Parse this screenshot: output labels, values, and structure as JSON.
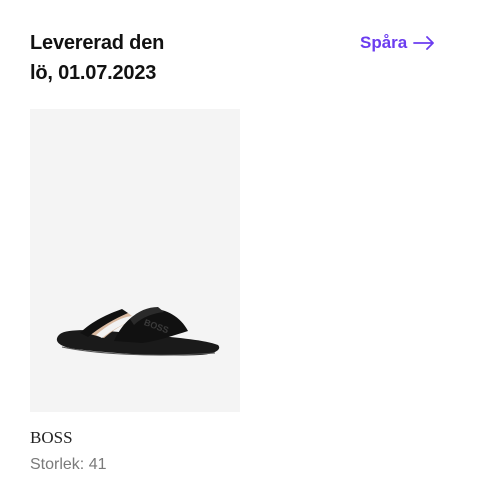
{
  "delivery": {
    "status_line1": "Levererad den",
    "status_line2": "lö, 01.07.2023"
  },
  "track": {
    "label": "Spåra",
    "icon": "arrow-right-icon",
    "color": "#6b3cf0"
  },
  "product": {
    "brand": "BOSS",
    "size_label": "Storlek: 41",
    "image_icon": "slide-sandal-image",
    "image_logo_text": "BOSS"
  }
}
